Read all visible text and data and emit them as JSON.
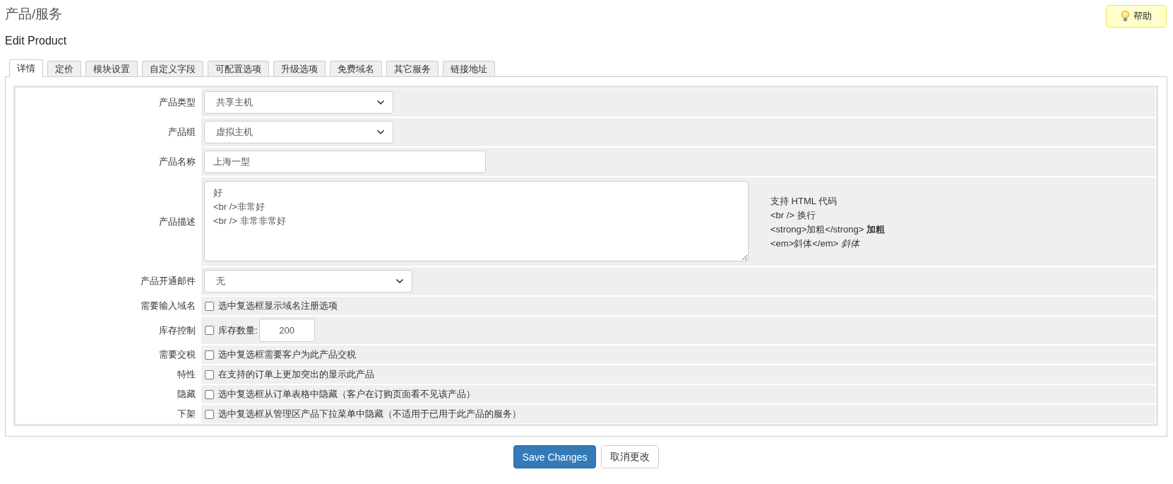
{
  "page": {
    "title": "产品/服务",
    "subtitle": "Edit Product"
  },
  "help_button": {
    "label": "帮助"
  },
  "tabs": [
    {
      "label": "详情",
      "selected": true
    },
    {
      "label": "定价",
      "selected": false
    },
    {
      "label": "模块设置",
      "selected": false
    },
    {
      "label": "自定义字段",
      "selected": false
    },
    {
      "label": "可配置选项",
      "selected": false
    },
    {
      "label": "升级选项",
      "selected": false
    },
    {
      "label": "免费域名",
      "selected": false
    },
    {
      "label": "其它服务",
      "selected": false
    },
    {
      "label": "链接地址",
      "selected": false
    }
  ],
  "form": {
    "rows": [
      {
        "kind": "select",
        "label": "产品类型",
        "value": "共享主机"
      },
      {
        "kind": "select",
        "label": "产品组",
        "value": "虚拟主机"
      },
      {
        "kind": "text",
        "label": "产品名称",
        "value": "上海一型"
      },
      {
        "kind": "textarea",
        "label": "产品描述",
        "value": "好\n<br />非常好\n<br /> 非常非常好",
        "hints": [
          "支持 HTML 代码",
          "<br /> 换行",
          "<strong>加粗</strong> **加粗**",
          "<em>斜体</em> *斜体*"
        ]
      },
      {
        "kind": "select",
        "label": "产品开通邮件",
        "value": "无"
      },
      {
        "kind": "checkbox",
        "label": "需要输入域名",
        "checked": false,
        "text": "选中复选框显示域名注册选项"
      },
      {
        "kind": "stock",
        "label": "库存控制",
        "checked": false,
        "text": "库存数量:",
        "value": "200"
      },
      {
        "kind": "checkbox",
        "label": "需要交税",
        "checked": false,
        "text": "选中复选框需要客户为此产品交税"
      },
      {
        "kind": "checkbox",
        "label": "特性",
        "checked": false,
        "text": "在支持的订单上更加突出的显示此产品"
      },
      {
        "kind": "checkbox",
        "label": "隐藏",
        "checked": false,
        "text": "选中复选框从订单表格中隐藏（客户在订购页面看不见该产品）"
      },
      {
        "kind": "checkbox",
        "label": "下架",
        "checked": false,
        "text": "选中复选框从管理区产品下拉菜单中隐藏（不适用于已用于此产品的服务）"
      }
    ]
  },
  "buttons": [
    {
      "kind": "primary",
      "label": "Save Changes"
    },
    {
      "kind": "default",
      "label": "取消更改"
    }
  ]
}
